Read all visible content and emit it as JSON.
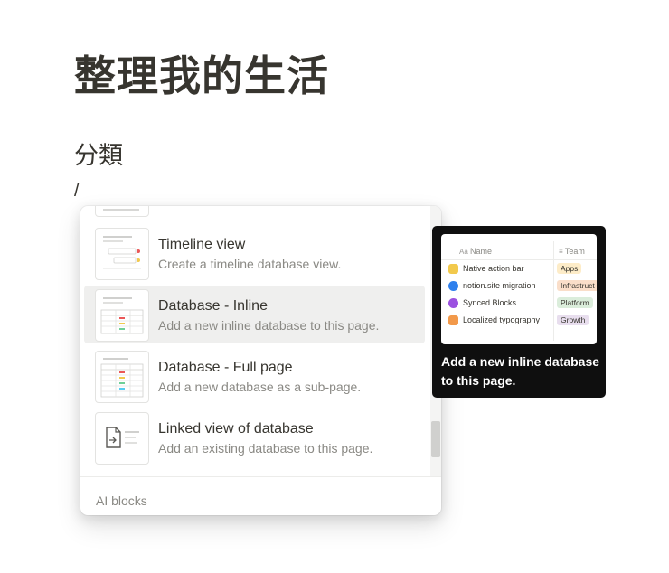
{
  "page": {
    "title": "整理我的生活",
    "heading": "分類",
    "slash": "/"
  },
  "menu": {
    "items": [
      {
        "title": "Timeline view",
        "description": "Create a timeline database view.",
        "icon": "timeline-thumbnail-icon"
      },
      {
        "title": "Database - Inline",
        "description": "Add a new inline database to this page.",
        "icon": "database-inline-thumbnail-icon"
      },
      {
        "title": "Database - Full page",
        "description": "Add a new database as a sub-page.",
        "icon": "database-full-page-thumbnail-icon"
      },
      {
        "title": "Linked view of database",
        "description": "Add an existing database to this page.",
        "icon": "linked-database-icon"
      }
    ],
    "section_label": "AI blocks"
  },
  "tooltip": {
    "text": "Add a new inline database to this page.",
    "preview": {
      "col_name": "Name",
      "col_team": "Team",
      "rows": [
        {
          "name": "Native action bar",
          "team": "Apps",
          "emoji": "pencil-icon"
        },
        {
          "name": "notion.site migration",
          "team": "Infrastruct",
          "emoji": "globe-icon"
        },
        {
          "name": "Synced Blocks",
          "team": "Platform",
          "emoji": "crystal-ball-icon"
        },
        {
          "name": "Localized typography",
          "team": "Growth",
          "emoji": "ab-icon"
        }
      ]
    }
  },
  "colors": {
    "hover_bg": "#efefee",
    "tooltip_bg": "#0f0f0f",
    "tag_apps": "#fdecc8",
    "tag_infra": "#fadec9",
    "tag_platform": "#dbeddb",
    "tag_growth": "#e8deee"
  }
}
